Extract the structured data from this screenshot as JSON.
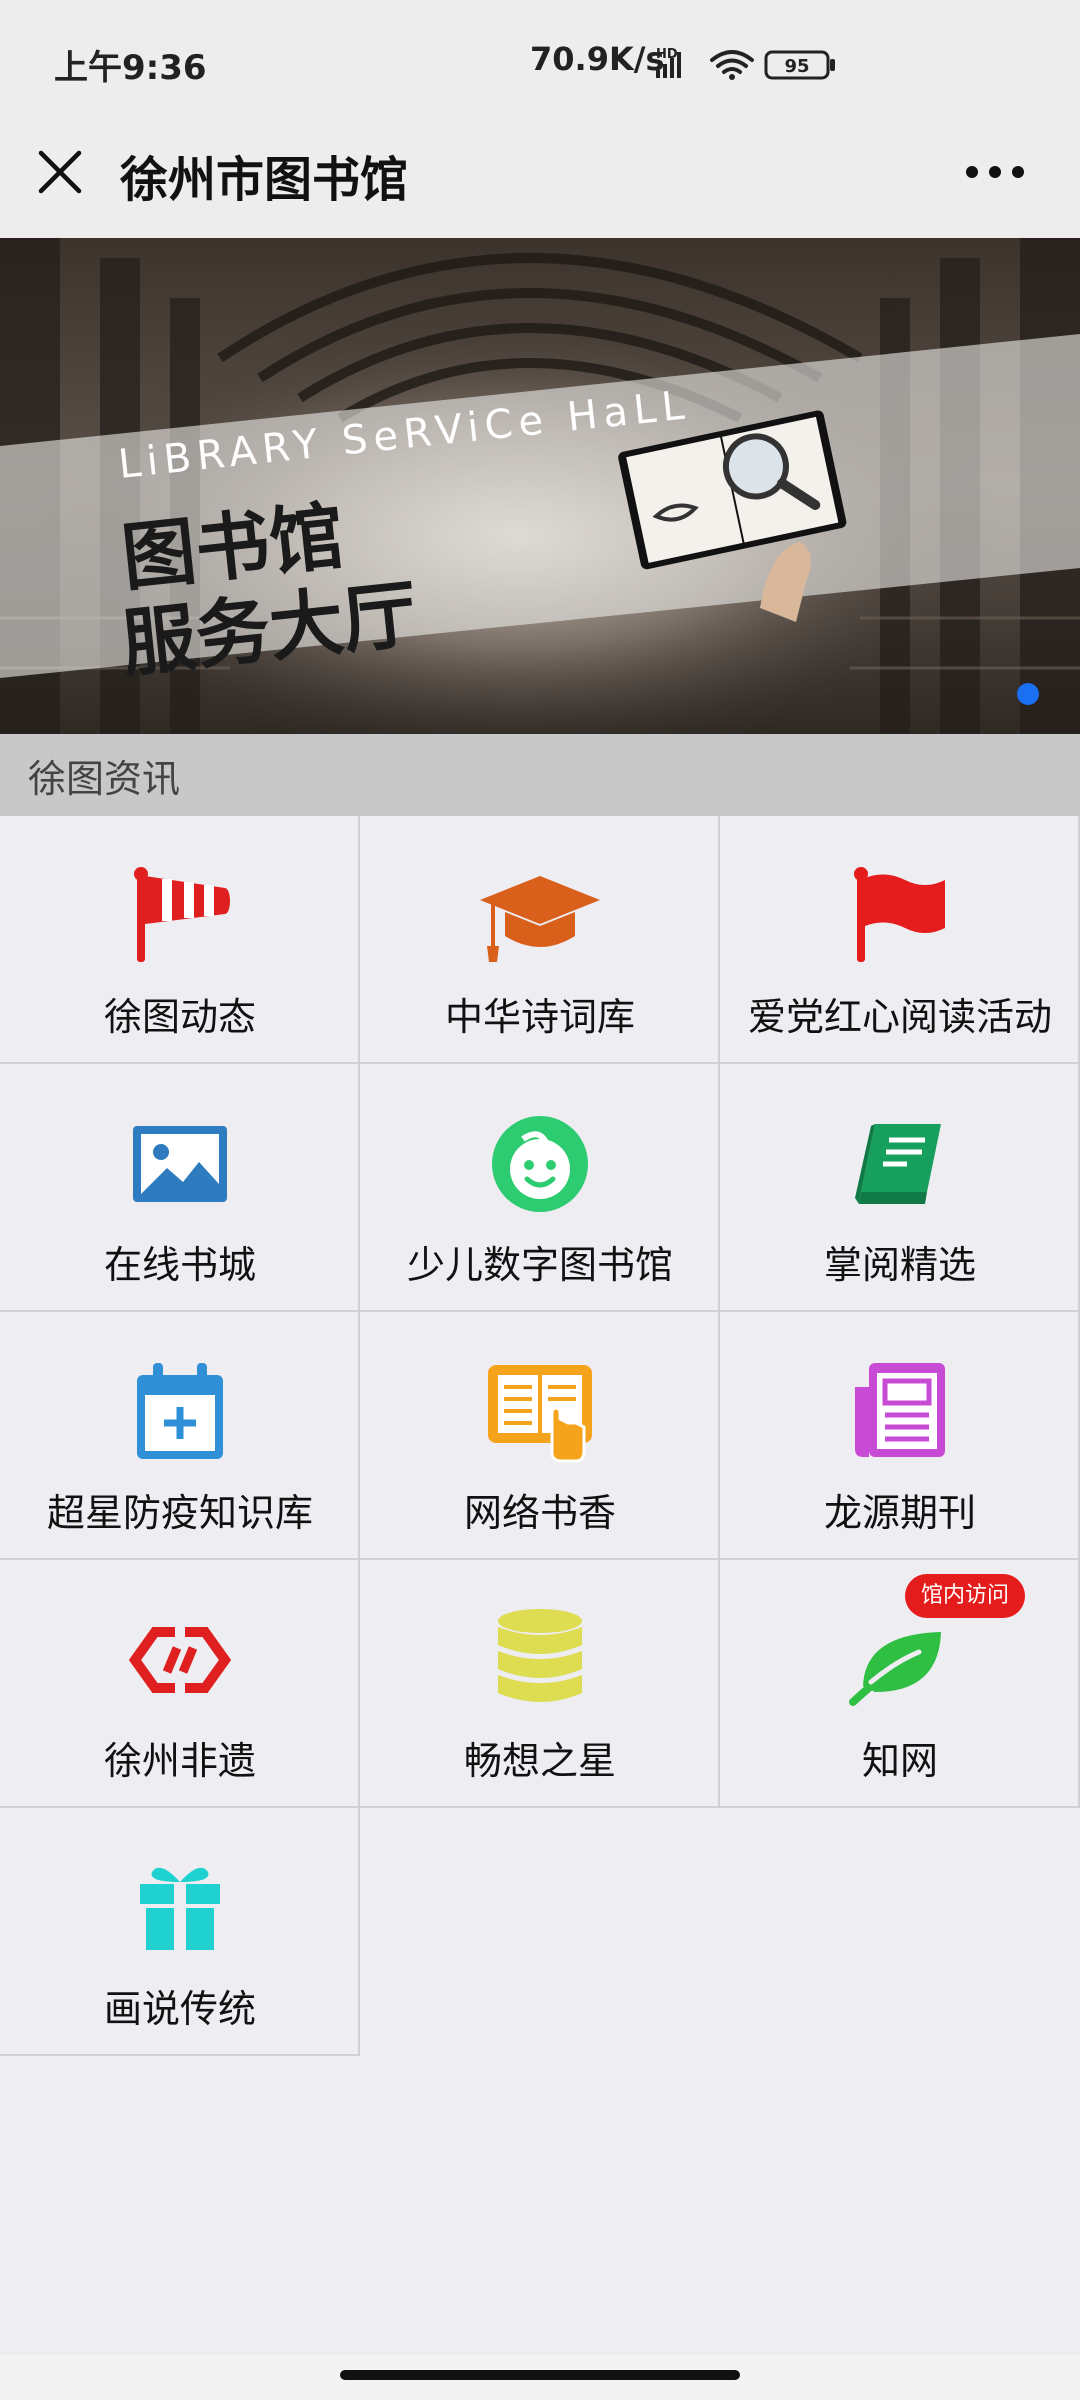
{
  "status": {
    "time": "上午9:36",
    "speed": "70.9K/s",
    "network": "HD",
    "battery": "95"
  },
  "header": {
    "title": "徐州市图书馆"
  },
  "banner": {
    "english": "LiBRARY SeRViCe HaLL",
    "line1": "图书馆",
    "line2": "服务大厅"
  },
  "section": {
    "title": "徐图资讯"
  },
  "grid": {
    "items": [
      {
        "label": "徐图动态",
        "icon": "windsock-flag-icon",
        "color": "#e02020"
      },
      {
        "label": "中华诗词库",
        "icon": "graduation-cap-icon",
        "color": "#d9601a"
      },
      {
        "label": "爱党红心阅读活动",
        "icon": "red-flag-icon",
        "color": "#e51c1c"
      },
      {
        "label": "在线书城",
        "icon": "image-icon",
        "color": "#2f7bbf"
      },
      {
        "label": "少儿数字图书馆",
        "icon": "smiley-face-icon",
        "color": "#2ecc71"
      },
      {
        "label": "掌阅精选",
        "icon": "book-icon",
        "color": "#17a05d"
      },
      {
        "label": "超星防疫知识库",
        "icon": "calendar-add-icon",
        "color": "#2f90d8"
      },
      {
        "label": "网络书香",
        "icon": "reading-hand-icon",
        "color": "#f5a31a"
      },
      {
        "label": "龙源期刊",
        "icon": "newspaper-icon",
        "color": "#c84bd6"
      },
      {
        "label": "徐州非遗",
        "icon": "chain-link-icon",
        "color": "#e02020"
      },
      {
        "label": "畅想之星",
        "icon": "database-stack-icon",
        "color": "#dedd52"
      },
      {
        "label": "知网",
        "icon": "leaf-icon",
        "color": "#2fbf43"
      },
      {
        "label": "画说传统",
        "icon": "gift-icon",
        "color": "#1fd1cf"
      }
    ],
    "badge": "馆内访问"
  }
}
